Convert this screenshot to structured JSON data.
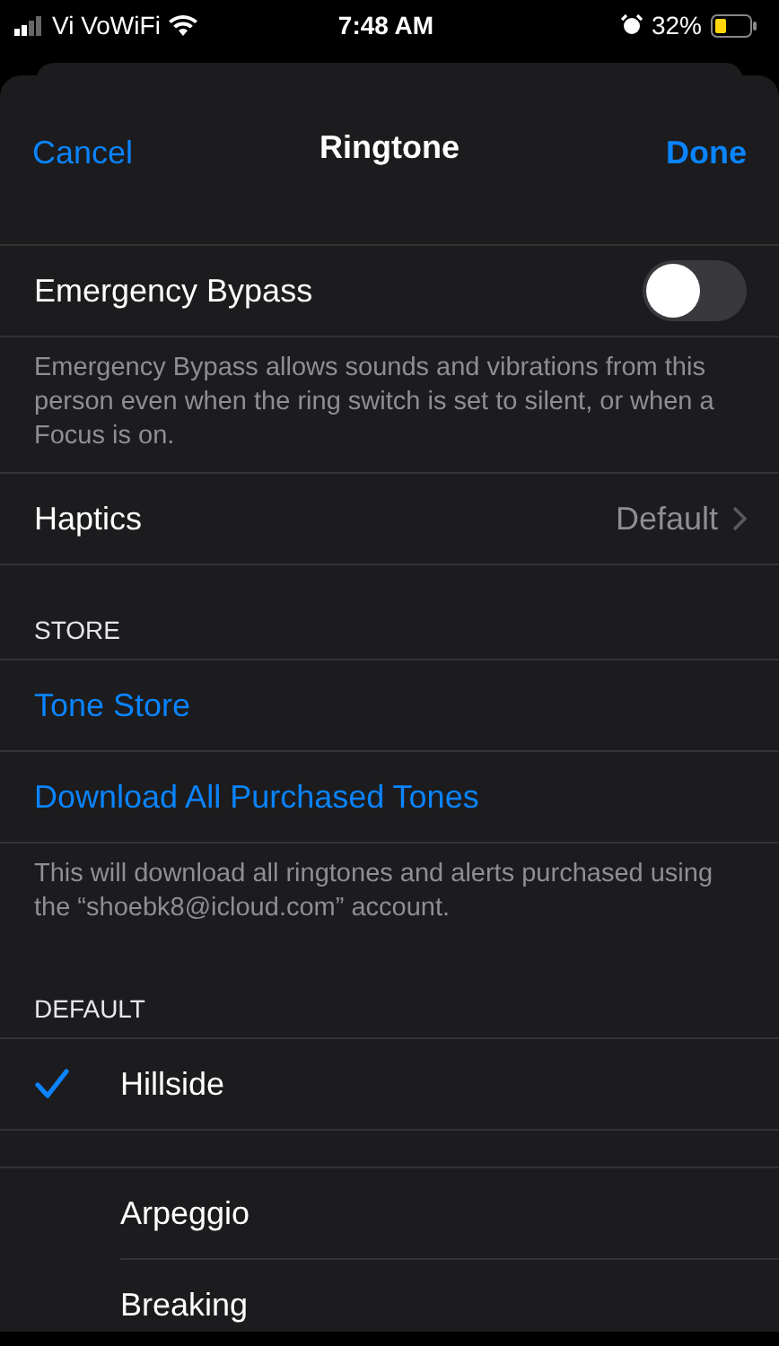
{
  "status_bar": {
    "carrier": "Vi VoWiFi",
    "time": "7:48 AM",
    "battery": "32%"
  },
  "nav": {
    "cancel": "Cancel",
    "title": "Ringtone",
    "done": "Done"
  },
  "emergency_bypass": {
    "label": "Emergency Bypass",
    "on": false
  },
  "emergency_footer": "Emergency Bypass allows sounds and vibrations from this person even when the ring switch is set to silent, or when a Focus is on.",
  "haptics": {
    "label": "Haptics",
    "value": "Default"
  },
  "store": {
    "header": "STORE",
    "items": [
      "Tone Store",
      "Download All Purchased Tones"
    ],
    "footer": "This will download all ringtones and alerts purchased using the “shoebk8@icloud.com” account."
  },
  "default": {
    "header": "DEFAULT",
    "tones": [
      {
        "name": "Hillside",
        "selected": true
      }
    ]
  },
  "ringtones": [
    {
      "name": "Arpeggio",
      "selected": false
    },
    {
      "name": "Breaking",
      "selected": false
    }
  ]
}
